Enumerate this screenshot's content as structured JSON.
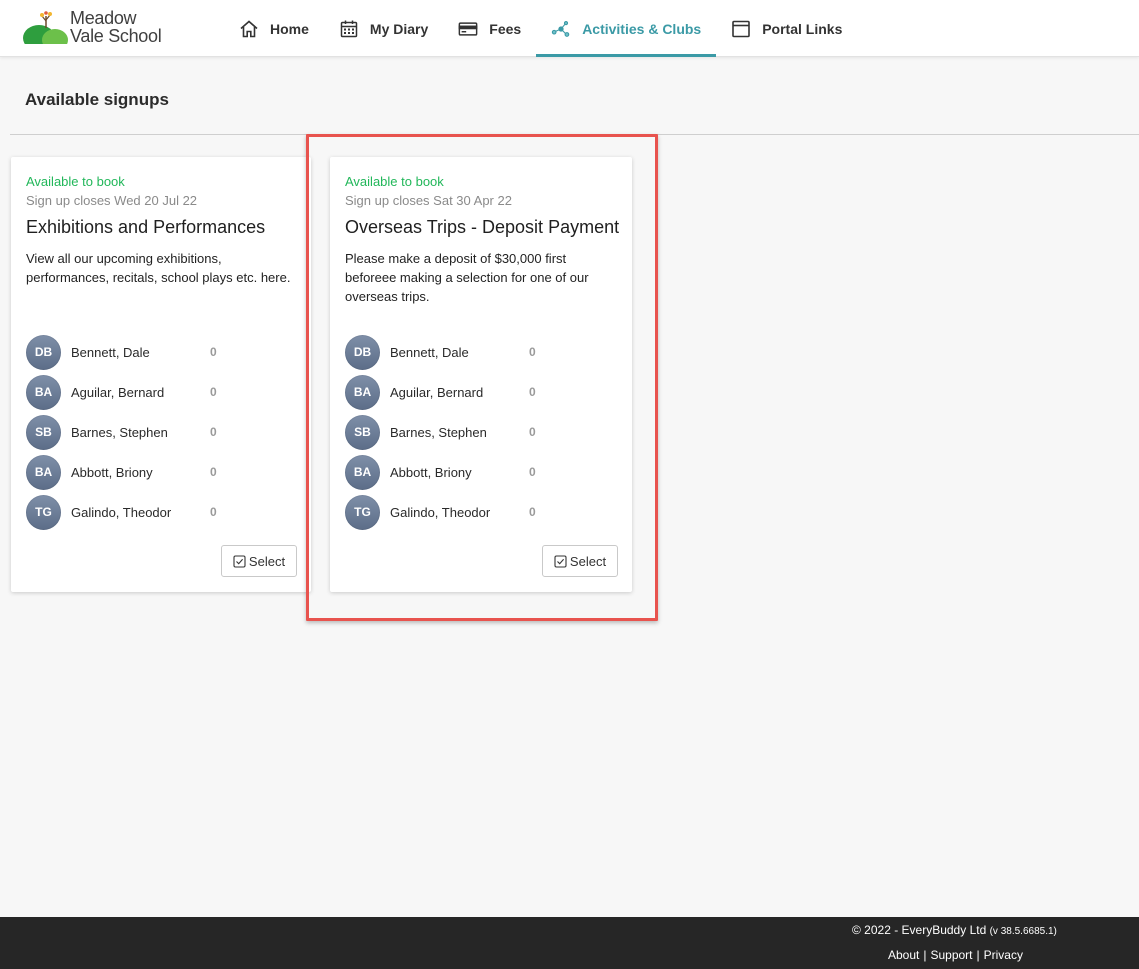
{
  "brand": {
    "line1": "Meadow",
    "line2": "Vale School"
  },
  "nav": {
    "items": [
      {
        "label": "Home",
        "icon": "home-icon"
      },
      {
        "label": "My Diary",
        "icon": "calendar-icon"
      },
      {
        "label": "Fees",
        "icon": "credit-card-icon"
      },
      {
        "label": "Activities & Clubs",
        "icon": "network-icon",
        "active": true
      },
      {
        "label": "Portal Links",
        "icon": "window-icon"
      }
    ],
    "accent_color": "#3b9aa6"
  },
  "page": {
    "title": "Available signups"
  },
  "cards": [
    {
      "status": "Available to book",
      "closes": "Sign up closes Wed 20 Jul 22",
      "title": "Exhibitions and Performances",
      "description": "View all our upcoming exhibitions, performances, recitals, school plays etc. here.",
      "select_label": "Select",
      "students": [
        {
          "initials": "DB",
          "name": "Bennett, Dale",
          "count": "0"
        },
        {
          "initials": "BA",
          "name": "Aguilar, Bernard",
          "count": "0"
        },
        {
          "initials": "SB",
          "name": "Barnes, Stephen",
          "count": "0"
        },
        {
          "initials": "BA",
          "name": "Abbott, Briony",
          "count": "0"
        },
        {
          "initials": "TG",
          "name": "Galindo, Theodor",
          "count": "0"
        }
      ]
    },
    {
      "status": "Available to book",
      "closes": "Sign up closes Sat 30 Apr 22",
      "title": "Overseas Trips - Deposit Payment",
      "description": "Please make a deposit of $30,000 first beforeee making a selection for one of our overseas trips.",
      "select_label": "Select",
      "students": [
        {
          "initials": "DB",
          "name": "Bennett, Dale",
          "count": "0"
        },
        {
          "initials": "BA",
          "name": "Aguilar, Bernard",
          "count": "0"
        },
        {
          "initials": "SB",
          "name": "Barnes, Stephen",
          "count": "0"
        },
        {
          "initials": "BA",
          "name": "Abbott, Briony",
          "count": "0"
        },
        {
          "initials": "TG",
          "name": "Galindo, Theodor",
          "count": "0"
        }
      ]
    }
  ],
  "status_color": "#22b75a",
  "highlight_color": "#e8534e",
  "footer": {
    "copyright": "© 2022 - EveryBuddy Ltd",
    "version": "(v 38.5.6685.1)",
    "links": [
      "About",
      "Support",
      "Privacy"
    ],
    "separator": "|"
  }
}
